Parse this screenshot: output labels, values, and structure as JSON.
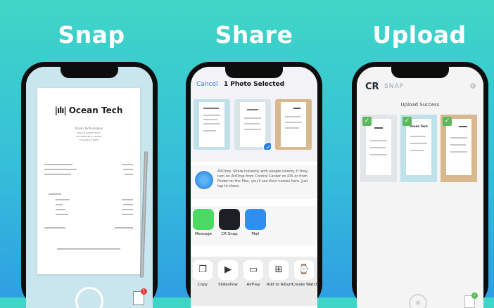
{
  "headings": {
    "snap": "Snap",
    "share": "Share",
    "upload": "Upload"
  },
  "phone1": {
    "receipt_logo": "Ocean Tech",
    "receipt_lines": [
      "Ocean Technologies",
      "1600 W SUNSET BLVD",
      "LOS ANGELES CA 90026",
      "7/20/2018 4:39PM"
    ],
    "badge_count": "1"
  },
  "phone2": {
    "cancel": "Cancel",
    "title": "1 Photo Selected",
    "airdrop_text": "AirDrop. Share instantly with people nearby. If they turn on AirDrop from Control Center on iOS or from Finder on the Mac, you'll see their names here. Just tap to share.",
    "apps": [
      "Message",
      "CR Snap",
      "Mail"
    ],
    "actions": [
      "Copy",
      "Slideshow",
      "AirPlay",
      "Add to Album",
      "Create Watch Fa"
    ]
  },
  "phone3": {
    "logo": "CR",
    "app_name": "SNAP",
    "status": "Upload Success",
    "tile_logo": "Ocean Tech"
  },
  "colors": {
    "accent_blue": "#2a7de1",
    "success_green": "#5cb85c",
    "bg_top": "#3fd6c6",
    "bg_bottom": "#2f9fe2"
  }
}
